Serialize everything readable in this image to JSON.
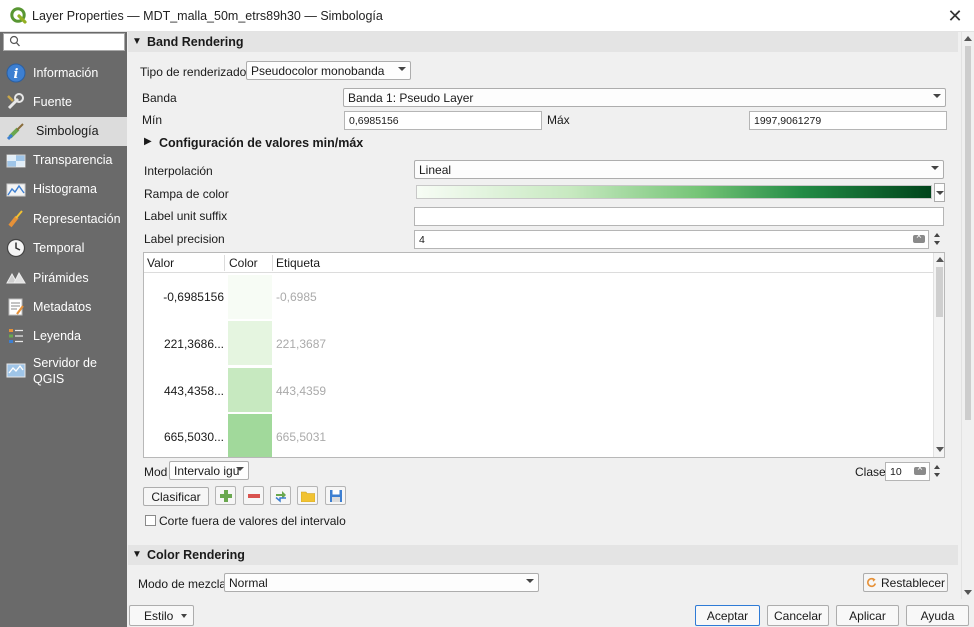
{
  "window": {
    "title": "Layer Properties — MDT_malla_50m_etrs89h30 — Simbología"
  },
  "sidebar": {
    "search_placeholder": "",
    "items": [
      {
        "label": "Información",
        "icon": "info-icon"
      },
      {
        "label": "Fuente",
        "icon": "source-icon"
      },
      {
        "label": "Simbología",
        "icon": "paintbrush-icon",
        "active": true
      },
      {
        "label": "Transparencia",
        "icon": "transparency-icon"
      },
      {
        "label": "Histograma",
        "icon": "histogram-icon"
      },
      {
        "label": "Representación",
        "icon": "rendering-icon"
      },
      {
        "label": "Temporal",
        "icon": "clock-icon"
      },
      {
        "label": "Pirámides",
        "icon": "pyramids-icon"
      },
      {
        "label": "Metadatos",
        "icon": "metadata-icon"
      },
      {
        "label": "Leyenda",
        "icon": "legend-icon"
      },
      {
        "label": "Servidor de QGIS",
        "icon": "server-icon"
      }
    ]
  },
  "band_rendering": {
    "header": "Band Rendering",
    "render_type_label": "Tipo de renderizador",
    "render_type_value": "Pseudocolor monobanda",
    "band_label": "Banda",
    "band_value": "Banda 1: Pseudo Layer",
    "min_label": "Mín",
    "min_value": "0,6985156",
    "max_label": "Máx",
    "max_value": "1997,9061279",
    "minmax_header": "Configuración de valores min/máx",
    "interp_label": "Interpolación",
    "interp_value": "Lineal",
    "ramp_label": "Rampa de color",
    "suffix_label": "Label unit suffix",
    "suffix_value": "",
    "precision_label": "Label precision",
    "precision_value": "4",
    "table": {
      "columns": [
        "Valor",
        "Color",
        "Etiqueta"
      ],
      "rows": [
        {
          "value": "-0,6985156",
          "color": "#f7fcf5",
          "label": "-0,6985"
        },
        {
          "value": "221,3686...",
          "color": "#e5f5e0",
          "label": "221,3687"
        },
        {
          "value": "443,4358...",
          "color": "#c7e9c0",
          "label": "443,4359"
        },
        {
          "value": "665,5030...",
          "color": "#a1d99b",
          "label": "665,5031"
        }
      ]
    },
    "mode_label": "Mod",
    "mode_value": "Intervalo igu",
    "classes_label": "Clase",
    "classes_value": "10",
    "classify_button": "Clasificar",
    "clip_checkbox_label": "Corte fuera de valores del intervalo"
  },
  "color_rendering": {
    "header": "Color Rendering",
    "blend_label": "Modo de mezcla",
    "blend_value": "Normal",
    "reset_button": "Restablecer"
  },
  "footer": {
    "style_button": "Estilo",
    "ok_button": "Aceptar",
    "cancel_button": "Cancelar",
    "apply_button": "Aplicar",
    "help_button": "Ayuda"
  }
}
